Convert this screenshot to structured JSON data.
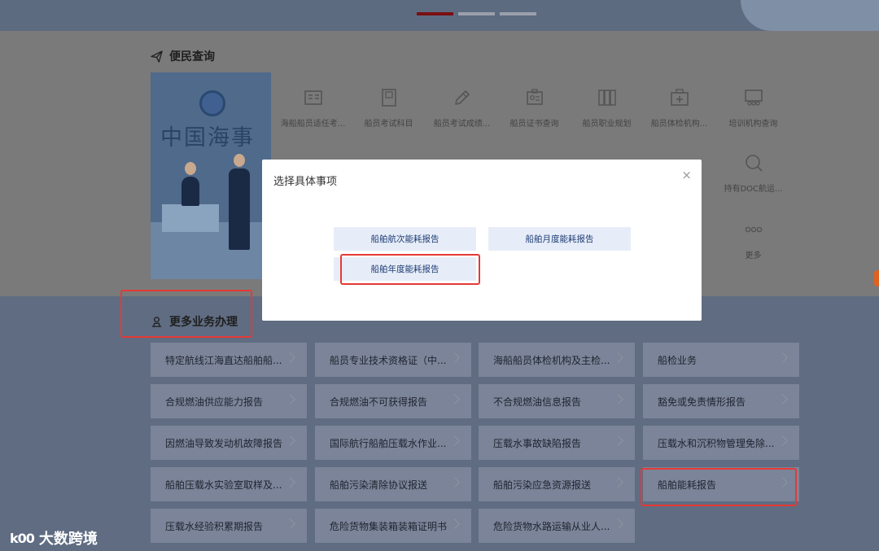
{
  "header": {
    "carousel_pages": 3,
    "carousel_active": 1
  },
  "section_query": {
    "title": "便民查询"
  },
  "hero": {
    "calligraphy": "中国海事"
  },
  "query_items": [
    {
      "label": "海船船员适任考...",
      "icon": "id-card-icon"
    },
    {
      "label": "船员考试科目",
      "icon": "book-icon"
    },
    {
      "label": "船员考试成绩...",
      "icon": "pencil-icon"
    },
    {
      "label": "船员证书查询",
      "icon": "certificate-icon"
    },
    {
      "label": "船员职业规划",
      "icon": "binders-icon"
    },
    {
      "label": "船员体检机构...",
      "icon": "medical-kit-icon"
    },
    {
      "label": "培训机构查询",
      "icon": "classroom-icon"
    },
    {
      "label": "持有DOC航运...",
      "icon": "search-doc-icon"
    },
    {
      "label": "更多",
      "icon": "more-dots-icon"
    }
  ],
  "section_more": {
    "title": "更多业务办理"
  },
  "business": [
    [
      "特定航线江海直达船舶船...",
      "船员专业技术资格证（中...",
      "海船船员体检机构及主检...",
      "船检业务"
    ],
    [
      "合规燃油供应能力报告",
      "合规燃油不可获得报告",
      "不合规燃油信息报告",
      "豁免或免责情形报告"
    ],
    [
      "因燃油导致发动机故障报告",
      "国际航行船舶压载水作业...",
      "压载水事故缺陷报告",
      "压载水和沉积物管理免除..."
    ],
    [
      "船舶压载水实验室取样及...",
      "船舶污染清除协议报送",
      "船舶污染应急资源报送",
      "船舶能耗报告"
    ],
    [
      "压载水经验积累期报告",
      "危险货物集装箱装箱证明书",
      "危险货物水路运输从业人..."
    ]
  ],
  "modal": {
    "title": "选择具体事项",
    "close": "×",
    "options": [
      "船舶航次能耗报告",
      "船舶月度能耗报告",
      "船舶年度能耗报告"
    ]
  },
  "watermark": {
    "logo": "k00",
    "text": "大数跨境"
  },
  "colors": {
    "accent": "#7a0f12",
    "highlight": "#e53935",
    "modal_button": "#e7edf8"
  }
}
